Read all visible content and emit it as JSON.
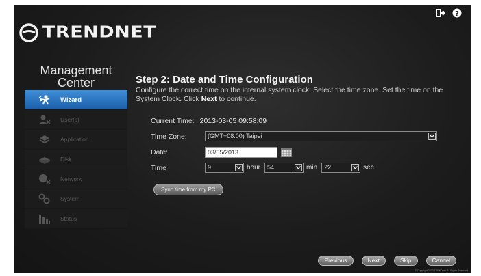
{
  "brand": {
    "name": "TRENDNET"
  },
  "top_icons": [
    "logout-icon",
    "help-icon"
  ],
  "sidebar": {
    "title_line1": "Management",
    "title_line2": "Center",
    "items": [
      {
        "label": "Wizard",
        "icon": "wizard-icon",
        "active": true
      },
      {
        "label": "User(s)",
        "icon": "users-icon",
        "active": false
      },
      {
        "label": "Application",
        "icon": "application-icon",
        "active": false
      },
      {
        "label": "Disk",
        "icon": "disk-icon",
        "active": false
      },
      {
        "label": "Network",
        "icon": "network-icon",
        "active": false
      },
      {
        "label": "System",
        "icon": "system-icon",
        "active": false
      },
      {
        "label": "Status",
        "icon": "status-icon",
        "active": false
      }
    ]
  },
  "main": {
    "title": "Step 2: Date and Time Configuration",
    "desc_part1": "Configure the correct time on the internal system clock. Select the time zone. Set the time on the System Clock. Click ",
    "desc_bold": "Next",
    "desc_part2": " to continue.",
    "current_time_label": "Current Time:",
    "current_time_value": "2013-03-05  09:58:09",
    "timezone_label": "Time Zone:",
    "timezone_value": "(GMT+08:00) Taipei",
    "date_label": "Date:",
    "date_value": "03/05/2013",
    "time_label": "Time",
    "hour_value": "9",
    "hour_unit": "hour",
    "min_value": "54",
    "min_unit": "min",
    "sec_value": "22",
    "sec_unit": "sec",
    "sync_label": "Sync time from my PC"
  },
  "buttons": {
    "previous": "Previous",
    "next": "Next",
    "skip": "Skip",
    "cancel": "Cancel"
  },
  "copyright": "© Copyright 2013 TRENDnet. All Rights Reserved.",
  "colors": {
    "active_blue": "#2e78c8",
    "background": "#1c1c1c"
  }
}
